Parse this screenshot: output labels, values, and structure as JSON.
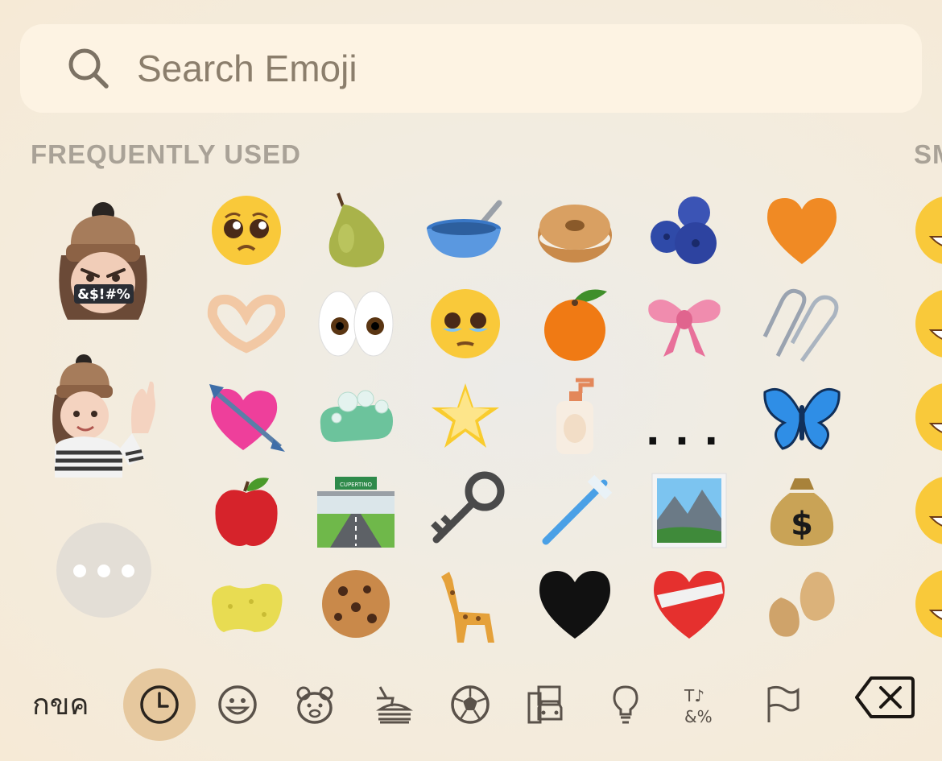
{
  "search": {
    "placeholder": "Search Emoji",
    "icon": "search-icon"
  },
  "sections": [
    {
      "title": "FREQUENTLY USED"
    },
    {
      "title": "SM"
    }
  ],
  "stickers": [
    {
      "name": "memoji-censored-sticker",
      "text": "&$!#%"
    },
    {
      "name": "memoji-waving-sticker"
    },
    {
      "name": "more-stickers-button"
    }
  ],
  "emoji_grid": [
    [
      "pleading-face",
      "pear",
      "bowl-with-spoon",
      "bagel",
      "blueberries",
      "orange-heart"
    ],
    [
      "heart-hands",
      "eyes",
      "face-holding-back-tears",
      "tangerine",
      "ribbon",
      "linked-paperclips"
    ],
    [
      "heart-with-arrow",
      "soap",
      "glowing-star",
      "lotion-bottle",
      "ellipsis-more",
      "butterfly"
    ],
    [
      "red-apple",
      "motorway",
      "old-key",
      "toothbrush",
      "framed-picture",
      "money-bag"
    ],
    [
      "sponge",
      "cookie",
      "giraffe",
      "black-heart",
      "mending-heart",
      "peanuts"
    ]
  ],
  "ellipsis_text": "...",
  "freeway_sign_text": "CUPERTINO",
  "smileys_partial": [
    "grinning-face",
    "grinning-face-big-eyes",
    "grinning-face-smiling-eyes",
    "beaming-face",
    "grinning-squinting-face"
  ],
  "bottom_bar": {
    "keyboard_label": "กขค",
    "categories": [
      "recent",
      "smileys",
      "animals",
      "food",
      "activity",
      "travel",
      "objects",
      "symbols",
      "flags"
    ],
    "active": "recent"
  },
  "colors": {
    "background": "#f4ebdc",
    "search_bg": "#fdf3e3",
    "search_text": "#8b7e6c",
    "section_title": "#a9a297",
    "active_tab": "#e6c89e",
    "icon": "#3a342d"
  }
}
